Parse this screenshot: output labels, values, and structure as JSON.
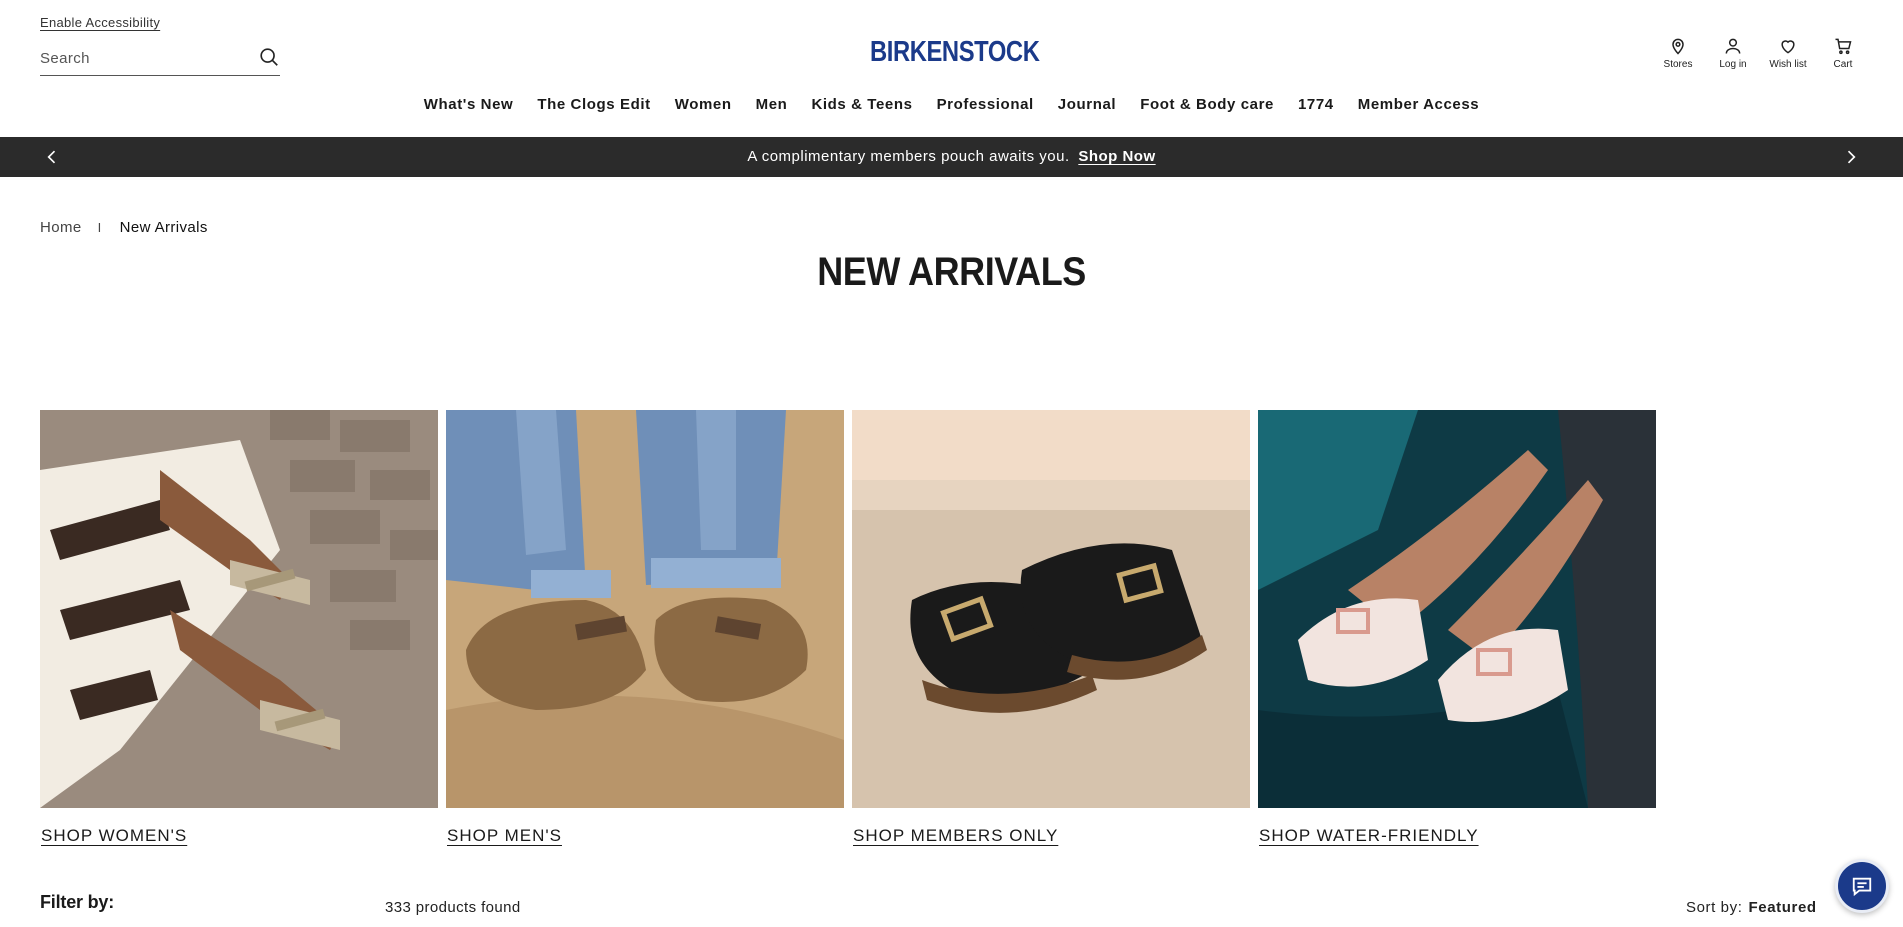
{
  "header": {
    "accessibility_label": "Enable Accessibility",
    "search_placeholder": "Search",
    "logo_text": "BIRKENSTOCK",
    "brand_color": "#1b3a8a",
    "utility": {
      "stores": "Stores",
      "login": "Log in",
      "wishlist": "Wish list",
      "cart": "Cart"
    }
  },
  "nav": {
    "items": [
      "What's New",
      "The Clogs Edit",
      "Women",
      "Men",
      "Kids & Teens",
      "Professional",
      "Journal",
      "Foot & Body care",
      "1774",
      "Member Access"
    ]
  },
  "promo": {
    "text": "A complimentary members pouch awaits you.",
    "link": "Shop Now",
    "background": "#2b2b2b"
  },
  "breadcrumb": {
    "home": "Home",
    "separator": "I",
    "current": "New Arrivals"
  },
  "page_title": "NEW ARRIVALS",
  "tiles": [
    {
      "label": "SHOP WOMEN'S"
    },
    {
      "label": "SHOP MEN'S"
    },
    {
      "label": "SHOP MEMBERS ONLY"
    },
    {
      "label": "SHOP WATER-FRIENDLY"
    }
  ],
  "filter": {
    "label": "Filter by:",
    "count_text": "333 products found",
    "sort_label": "Sort by:",
    "sort_value": "Featured"
  }
}
